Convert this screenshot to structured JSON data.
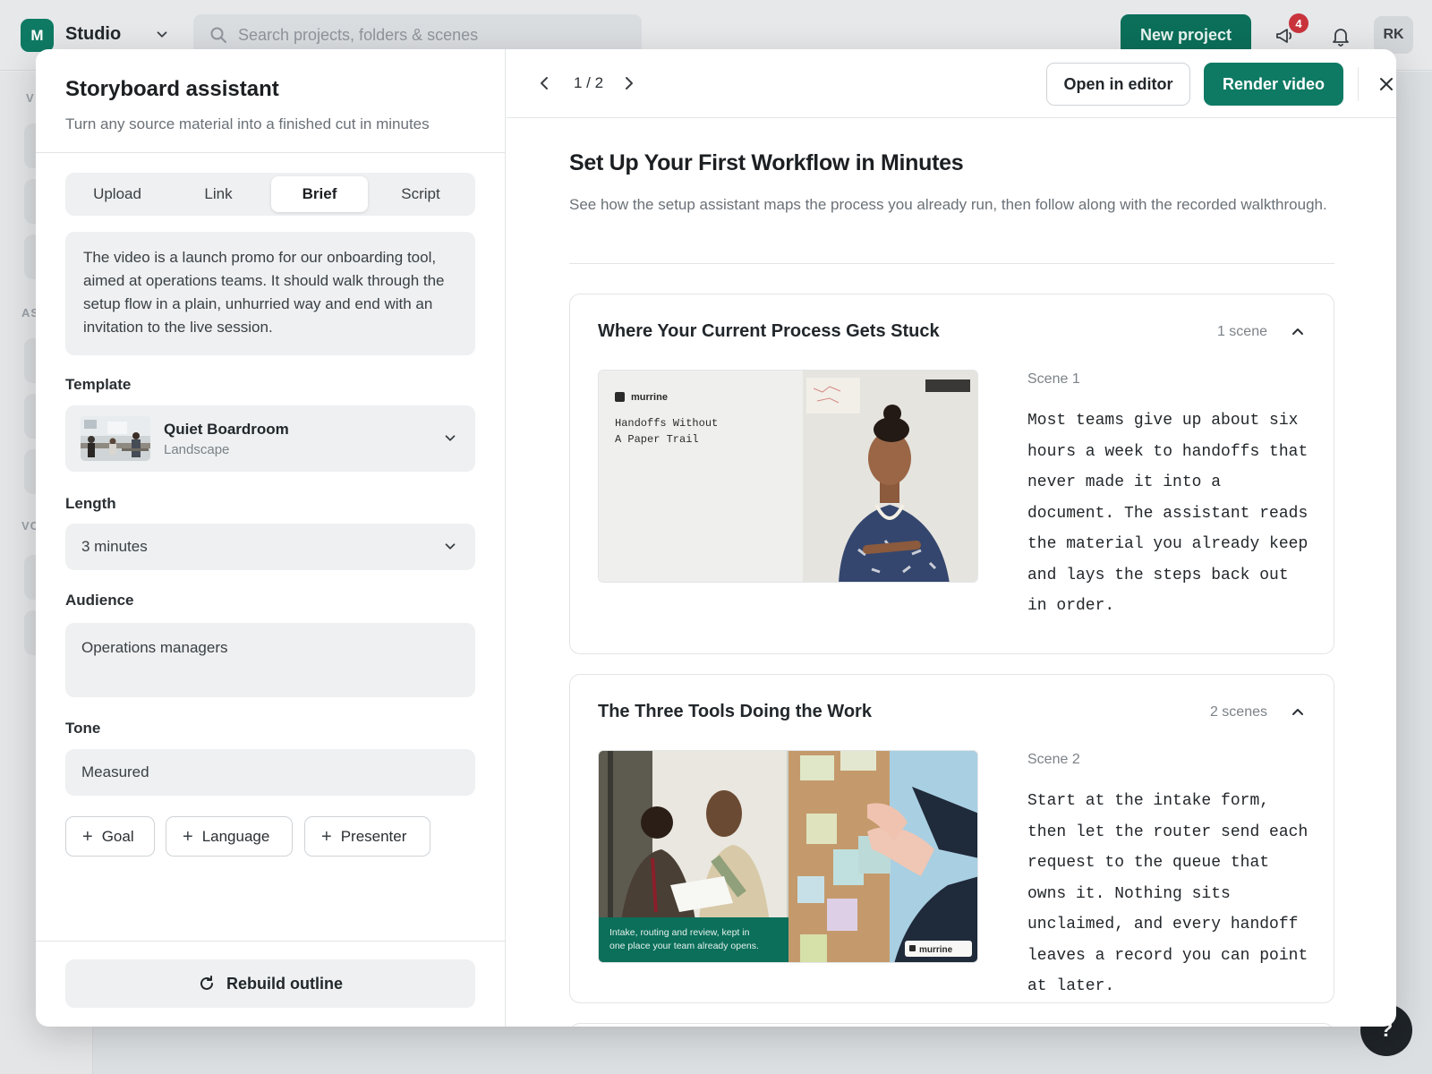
{
  "app": {
    "brand_initial": "M",
    "brand_name": "Studio",
    "search_placeholder": "Search projects, folders & scenes",
    "new_project_label": "New project",
    "notification_count": "4",
    "user_initials": "RK",
    "help_label": "?",
    "sidebar_labels": [
      "V",
      "AS",
      "VC"
    ]
  },
  "assistant": {
    "title": "Storyboard assistant",
    "subtitle": "Turn any source material into a finished cut in minutes",
    "tabs": [
      {
        "label": "Upload",
        "active": false
      },
      {
        "label": "Link",
        "active": false
      },
      {
        "label": "Brief",
        "active": true
      },
      {
        "label": "Script",
        "active": false
      }
    ],
    "brief_text": "The video is a launch promo for our onboarding tool, aimed at operations teams. It should walk through the setup flow in a plain, unhurried way and end with an invitation to the live session.",
    "template_label": "Template",
    "template_name": "Quiet Boardroom",
    "template_orientation": "Landscape",
    "length_label": "Length",
    "length_value": "3 minutes",
    "audience_label": "Audience",
    "audience_value": "Operations managers",
    "tone_label": "Tone",
    "tone_value": "Measured",
    "chips": [
      "Goal",
      "Language",
      "Presenter"
    ],
    "rebuild_label": "Rebuild outline"
  },
  "preview": {
    "pager": "1 / 2",
    "open_editor_label": "Open in editor",
    "render_label": "Render video",
    "title": "Set Up Your First Workflow in Minutes",
    "description": "See how the setup assistant maps the process you already run, then follow along with the recorded walkthrough.",
    "sections": [
      {
        "title": "Where Your Current Process Gets Stuck",
        "count": "1 scene",
        "scene_label": "Scene 1",
        "scene_text": "Most teams give up about six hours a week to handoffs that never made it into a document. The assistant reads the material you already keep and lays the steps back out in order.",
        "thumb_brand": "murrine",
        "thumb_caption_1": "Handoffs Without",
        "thumb_caption_2": "A Paper Trail"
      },
      {
        "title": "The Three Tools Doing the Work",
        "count": "2 scenes",
        "scene_label": "Scene 2",
        "scene_text": "Start at the intake form, then let the router send each request to the queue that owns it. Nothing sits unclaimed, and every handoff leaves a record you can point at later.",
        "thumb_caption_1": "Intake, routing and review, kept in",
        "thumb_caption_2": "one place your team already opens.",
        "thumb_brand": "murrine"
      }
    ]
  },
  "colors": {
    "accent": "#0f7a64",
    "badge": "#c9333c"
  }
}
